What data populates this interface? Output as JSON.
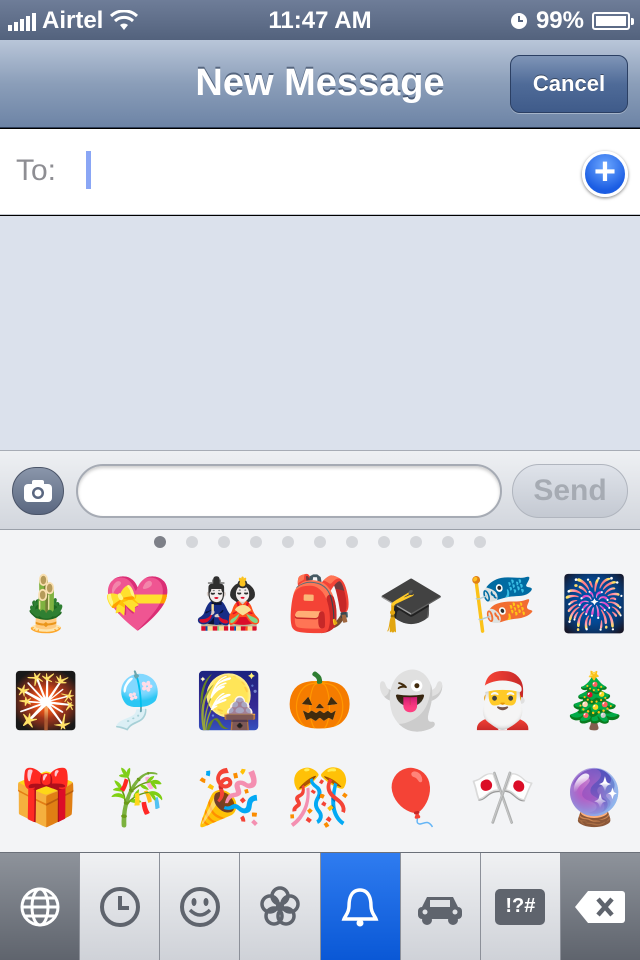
{
  "status_bar": {
    "carrier": "Airtel",
    "time": "11:47 AM",
    "battery_percent": "99%",
    "battery_level": 0.99
  },
  "nav": {
    "title": "New Message",
    "cancel_label": "Cancel"
  },
  "to_field": {
    "label": "To:"
  },
  "compose": {
    "input_value": "",
    "send_label": "Send"
  },
  "emoji_keyboard": {
    "page_count": 11,
    "active_page": 0,
    "emojis": [
      "🎍",
      "💝",
      "🎎",
      "🎒",
      "🎓",
      "🎏",
      "🎆",
      "🎇",
      "🎐",
      "🎑",
      "🎃",
      "👻",
      "🎅",
      "🎄",
      "🎁",
      "🎋",
      "🎉",
      "🎊",
      "🎈",
      "🎌",
      "🔮"
    ]
  },
  "category_bar": {
    "keys": [
      {
        "name": "globe-icon",
        "active": false
      },
      {
        "name": "recent-clock-icon",
        "active": false
      },
      {
        "name": "smiley-icon",
        "active": false
      },
      {
        "name": "flower-icon",
        "active": false
      },
      {
        "name": "bell-icon",
        "active": true
      },
      {
        "name": "car-icon",
        "active": false
      },
      {
        "name": "symbols-icon",
        "active": false,
        "label": "!?#"
      },
      {
        "name": "delete-icon",
        "active": false
      }
    ]
  },
  "colors": {
    "accent": "#0a58d6",
    "nav_bar": "#8b9eb9",
    "message_bg": "#dbe1ec"
  }
}
